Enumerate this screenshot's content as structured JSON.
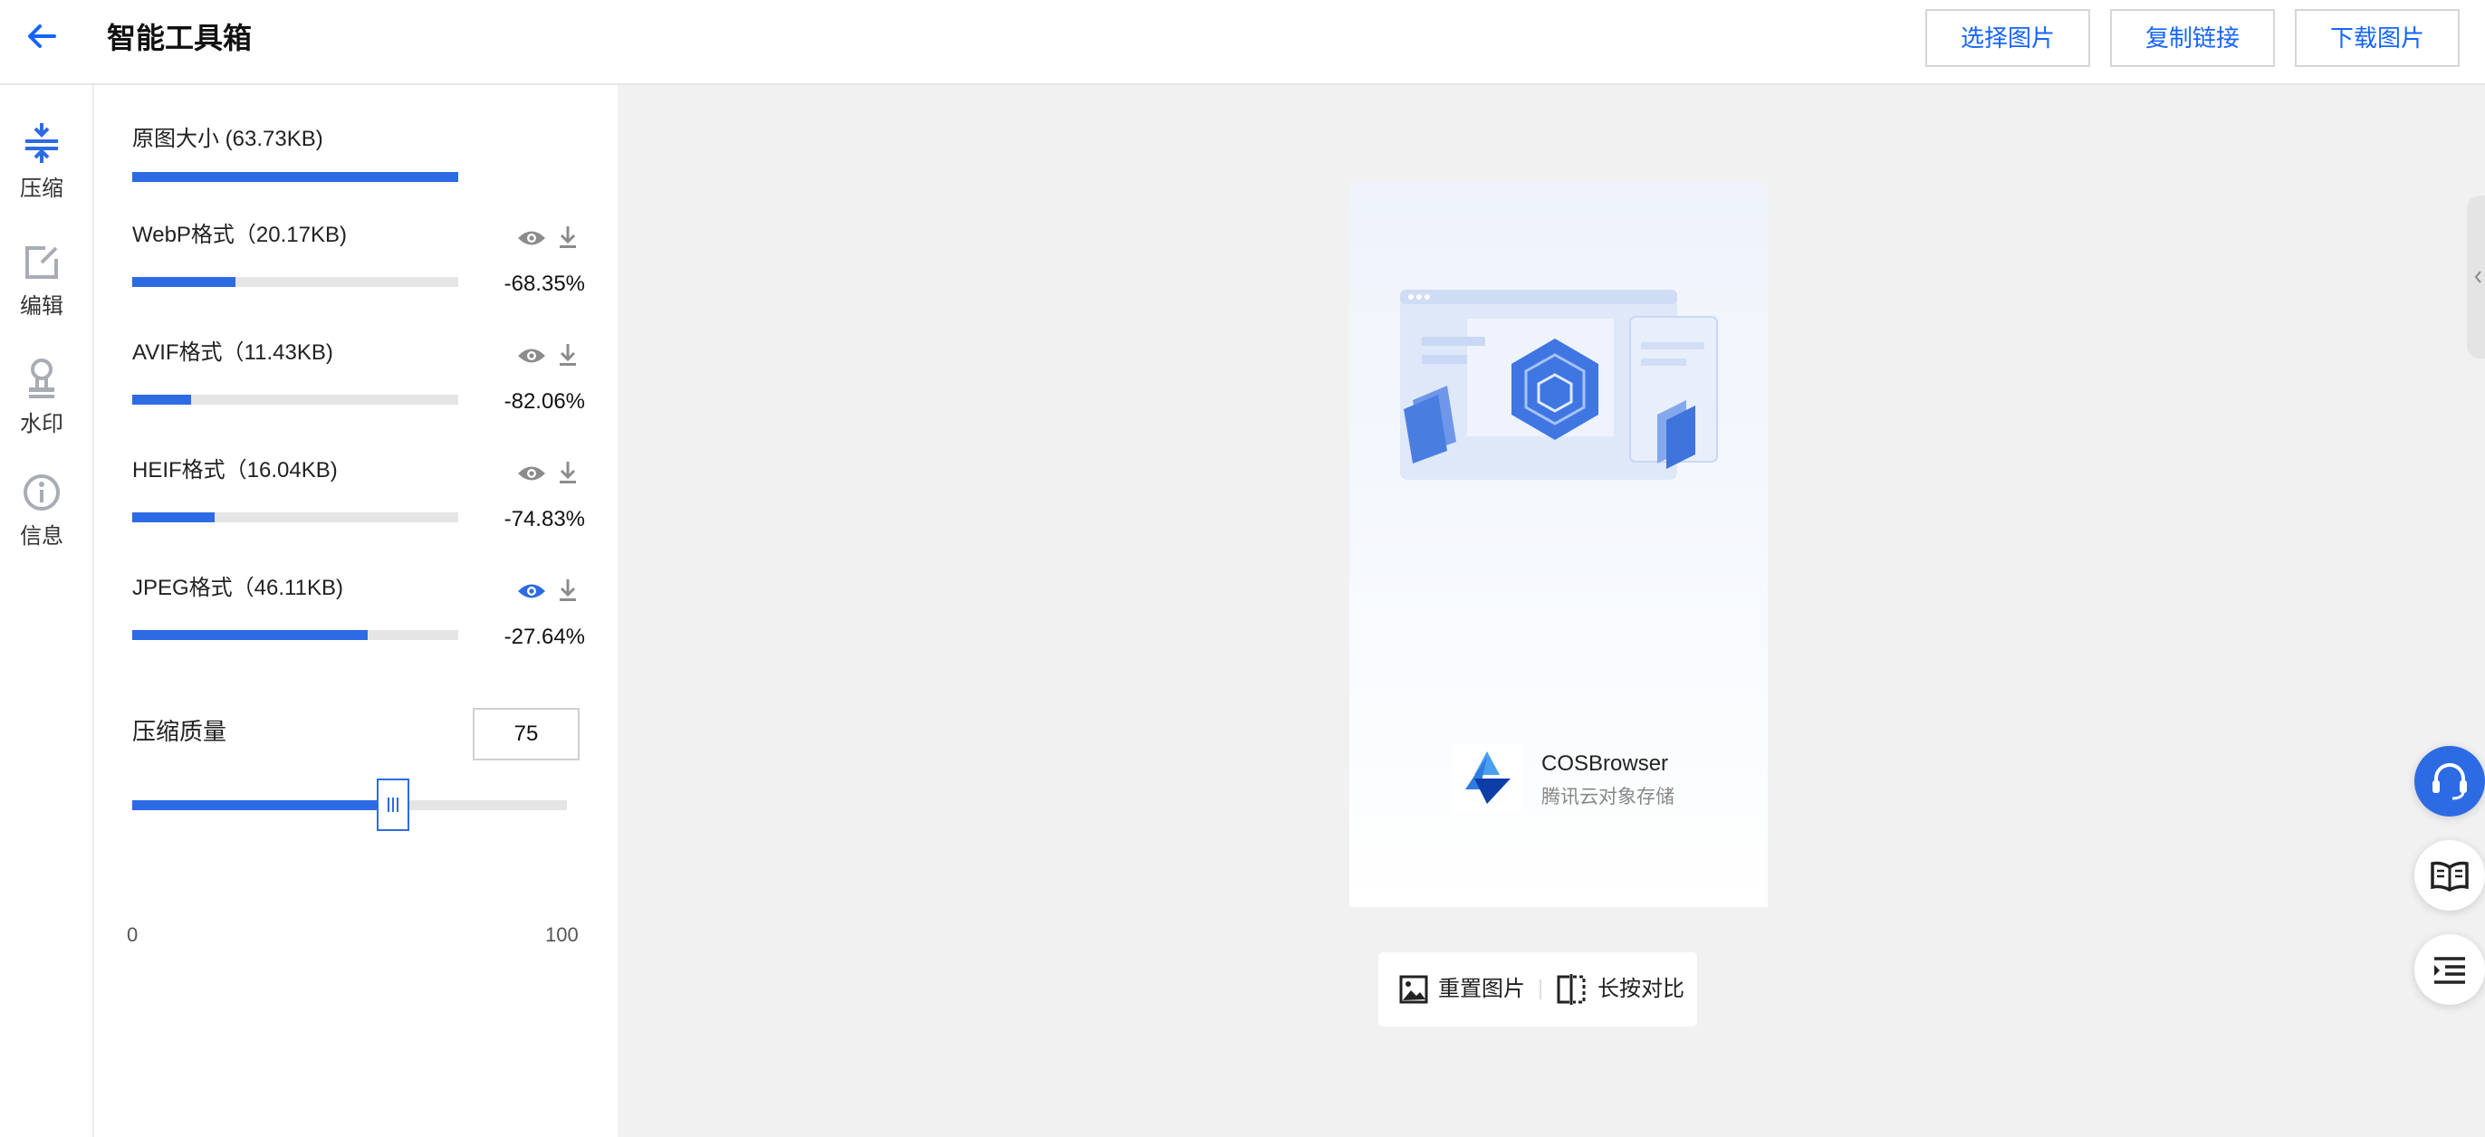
{
  "header": {
    "title": "智能工具箱",
    "buttons": {
      "select": "选择图片",
      "copy_link": "复制链接",
      "download": "下载图片"
    }
  },
  "tools": [
    {
      "label": "压缩",
      "icon": "compress-icon",
      "active": true
    },
    {
      "label": "编辑",
      "icon": "edit-icon",
      "active": false
    },
    {
      "label": "水印",
      "icon": "watermark-icon",
      "active": false
    },
    {
      "label": "信息",
      "icon": "info-icon",
      "active": false
    }
  ],
  "compress": {
    "original": {
      "label": "原图大小 (63.73KB)",
      "fill": 1.0
    },
    "formats": [
      {
        "label": "WebP格式（20.17KB)",
        "pct": "-68.35%",
        "fill": 0.3165,
        "active": false
      },
      {
        "label": "AVIF格式（11.43KB)",
        "pct": "-82.06%",
        "fill": 0.1794,
        "active": false
      },
      {
        "label": "HEIF格式（16.04KB)",
        "pct": "-74.83%",
        "fill": 0.2517,
        "active": false
      },
      {
        "label": "JPEG格式（46.11KB)",
        "pct": "-27.64%",
        "fill": 0.7236,
        "active": true
      }
    ],
    "quality": {
      "label": "压缩质量",
      "value": "75",
      "min": "0",
      "max": "100",
      "level": 75
    }
  },
  "preview": {
    "brand_title": "COSBrowser",
    "brand_subtitle": "腾讯云对象存储",
    "actions": {
      "reset": "重置图片",
      "compare": "长按对比"
    }
  },
  "colors": {
    "accent": "#2d6be4",
    "link": "#1664ff",
    "bg": "#f1f1f1"
  }
}
